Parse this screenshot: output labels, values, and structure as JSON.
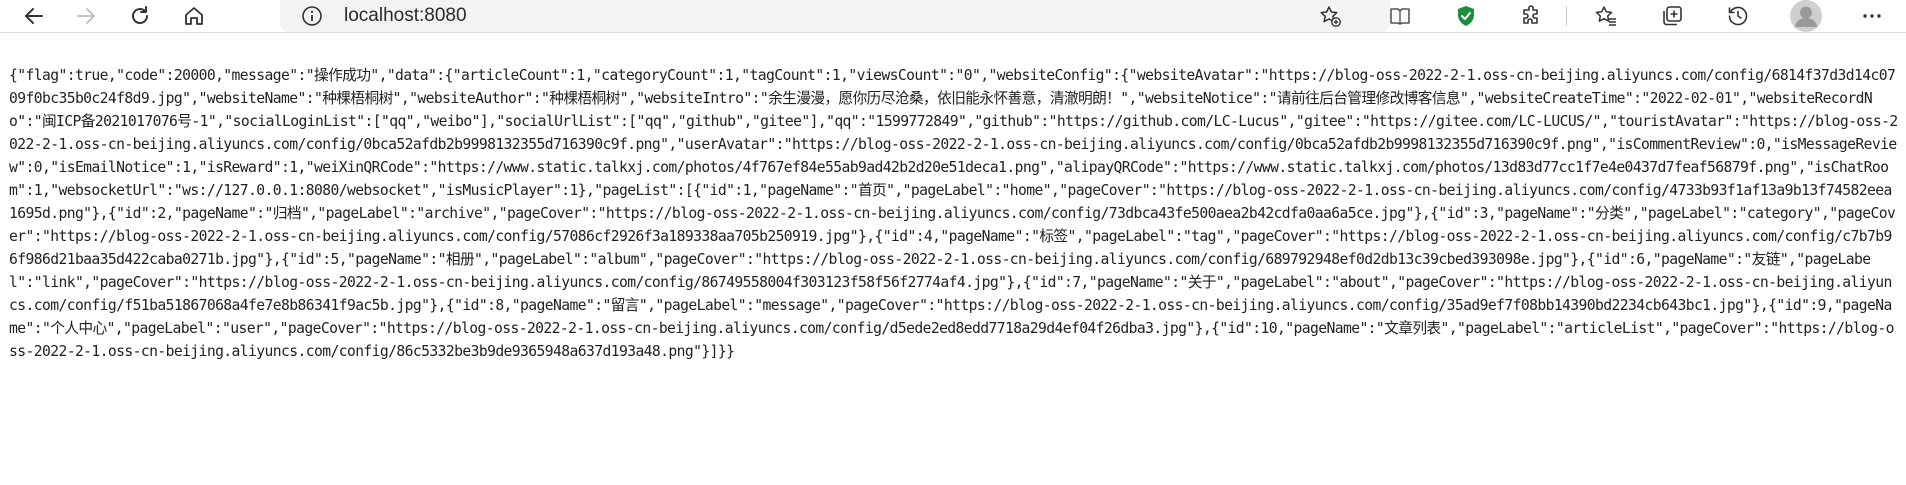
{
  "browser": {
    "url": "localhost:8080",
    "accent_color": "#1e8e3e",
    "icons": [
      "back-icon",
      "forward-icon",
      "refresh-icon",
      "home-icon",
      "info-icon",
      "favorite-add-icon",
      "reading-view-icon",
      "shield-icon",
      "extensions-icon",
      "favorites-icon",
      "collections-icon",
      "history-icon",
      "profile-icon",
      "more-icon"
    ]
  },
  "page": {
    "json_text": "{\"flag\":true,\"code\":20000,\"message\":\"操作成功\",\"data\":{\"articleCount\":1,\"categoryCount\":1,\"tagCount\":1,\"viewsCount\":\"0\",\"websiteConfig\":{\"websiteAvatar\":\"https://blog-oss-2022-2-1.oss-cn-beijing.aliyuncs.com/config/6814f37d3d14c0709f0bc35b0c24f8d9.jpg\",\"websiteName\":\"种棵梧桐树\",\"websiteAuthor\":\"种棵梧桐树\",\"websiteIntro\":\"余生漫漫，愿你历尽沧桑，依旧能永怀善意，清澈明朗！\",\"websiteNotice\":\"请前往后台管理修改博客信息\",\"websiteCreateTime\":\"2022-02-01\",\"websiteRecordNo\":\"闽ICP备2021017076号-1\",\"socialLoginList\":[\"qq\",\"weibo\"],\"socialUrlList\":[\"qq\",\"github\",\"gitee\"],\"qq\":\"1599772849\",\"github\":\"https://github.com/LC-Lucus\",\"gitee\":\"https://gitee.com/LC-LUCUS/\",\"touristAvatar\":\"https://blog-oss-2022-2-1.oss-cn-beijing.aliyuncs.com/config/0bca52afdb2b9998132355d716390c9f.png\",\"userAvatar\":\"https://blog-oss-2022-2-1.oss-cn-beijing.aliyuncs.com/config/0bca52afdb2b9998132355d716390c9f.png\",\"isCommentReview\":0,\"isMessageReview\":0,\"isEmailNotice\":1,\"isReward\":1,\"weiXinQRCode\":\"https://www.static.talkxj.com/photos/4f767ef84e55ab9ad42b2d20e51deca1.png\",\"alipayQRCode\":\"https://www.static.talkxj.com/photos/13d83d77cc1f7e4e0437d7feaf56879f.png\",\"isChatRoom\":1,\"websocketUrl\":\"ws://127.0.0.1:8080/websocket\",\"isMusicPlayer\":1},\"pageList\":[{\"id\":1,\"pageName\":\"首页\",\"pageLabel\":\"home\",\"pageCover\":\"https://blog-oss-2022-2-1.oss-cn-beijing.aliyuncs.com/config/4733b93f1af13a9b13f74582eea1695d.png\"},{\"id\":2,\"pageName\":\"归档\",\"pageLabel\":\"archive\",\"pageCover\":\"https://blog-oss-2022-2-1.oss-cn-beijing.aliyuncs.com/config/73dbca43fe500aea2b42cdfa0aa6a5ce.jpg\"},{\"id\":3,\"pageName\":\"分类\",\"pageLabel\":\"category\",\"pageCover\":\"https://blog-oss-2022-2-1.oss-cn-beijing.aliyuncs.com/config/57086cf2926f3a189338aa705b250919.jpg\"},{\"id\":4,\"pageName\":\"标签\",\"pageLabel\":\"tag\",\"pageCover\":\"https://blog-oss-2022-2-1.oss-cn-beijing.aliyuncs.com/config/c7b7b96f986d21baa35d422caba0271b.jpg\"},{\"id\":5,\"pageName\":\"相册\",\"pageLabel\":\"album\",\"pageCover\":\"https://blog-oss-2022-2-1.oss-cn-beijing.aliyuncs.com/config/689792948ef0d2db13c39cbed393098e.jpg\"},{\"id\":6,\"pageName\":\"友链\",\"pageLabel\":\"link\",\"pageCover\":\"https://blog-oss-2022-2-1.oss-cn-beijing.aliyuncs.com/config/86749558004f303123f58f56f2774af4.jpg\"},{\"id\":7,\"pageName\":\"关于\",\"pageLabel\":\"about\",\"pageCover\":\"https://blog-oss-2022-2-1.oss-cn-beijing.aliyuncs.com/config/f51ba51867068a4fe7e8b86341f9ac5b.jpg\"},{\"id\":8,\"pageName\":\"留言\",\"pageLabel\":\"message\",\"pageCover\":\"https://blog-oss-2022-2-1.oss-cn-beijing.aliyuncs.com/config/35ad9ef7f08bb14390bd2234cb643bc1.jpg\"},{\"id\":9,\"pageName\":\"个人中心\",\"pageLabel\":\"user\",\"pageCover\":\"https://blog-oss-2022-2-1.oss-cn-beijing.aliyuncs.com/config/d5ede2ed8edd7718a29d4ef04f26dba3.jpg\"},{\"id\":10,\"pageName\":\"文章列表\",\"pageLabel\":\"articleList\",\"pageCover\":\"https://blog-oss-2022-2-1.oss-cn-beijing.aliyuncs.com/config/86c5332be3b9de9365948a637d193a48.png\"}]}}"
  }
}
